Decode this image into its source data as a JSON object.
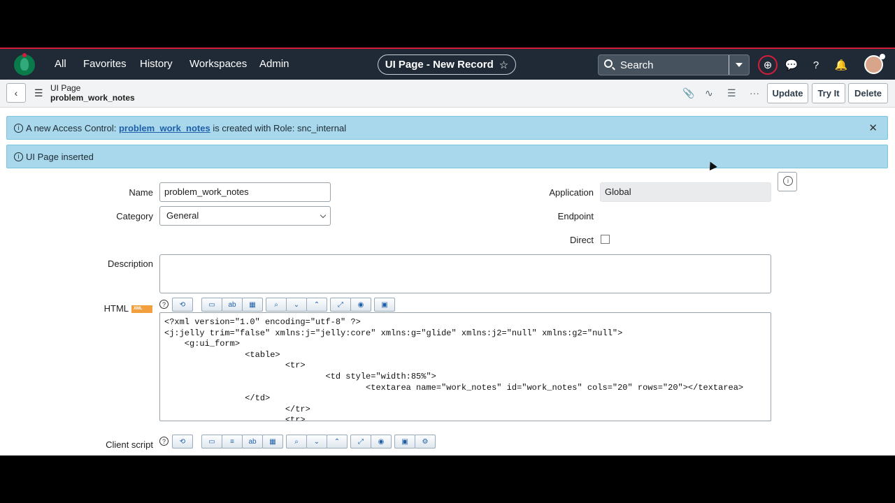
{
  "nav": {
    "links": [
      "All",
      "Favorites",
      "History",
      "Workspaces",
      "Admin"
    ],
    "title_pill": "UI Page - New Record",
    "search_placeholder": "Search"
  },
  "record": {
    "type": "UI Page",
    "name": "problem_work_notes",
    "buttons": {
      "update": "Update",
      "try_it": "Try It",
      "delete": "Delete"
    }
  },
  "banners": {
    "access_prefix": "A new Access Control: ",
    "access_link": "problem_work_notes",
    "access_suffix": " is created with Role: snc_internal",
    "inserted": "UI Page inserted"
  },
  "form": {
    "name_label": "Name",
    "name_value": "problem_work_notes",
    "category_label": "Category",
    "category_value": "General",
    "application_label": "Application",
    "application_value": "Global",
    "endpoint_label": "Endpoint",
    "direct_label": "Direct",
    "description_label": "Description",
    "html_label": "HTML",
    "xml_badge": "XML",
    "client_script_label": "Client script",
    "code_lines": [
      "<?xml version=\"1.0\" encoding=\"utf-8\" ?>",
      "<j:jelly trim=\"false\" xmlns:j=\"jelly:core\" xmlns:g=\"glide\" xmlns:j2=\"null\" xmlns:g2=\"null\">",
      "    <g:ui_form>",
      "                <table>",
      "                        <tr>",
      "                                <td style=\"width:85%\">",
      "                                        <textarea name=\"work_notes\" id=\"work_notes\" cols=\"20\" rows=\"20\"></textarea>",
      "                </td>",
      "                        </tr>",
      "                        <tr>"
    ]
  }
}
